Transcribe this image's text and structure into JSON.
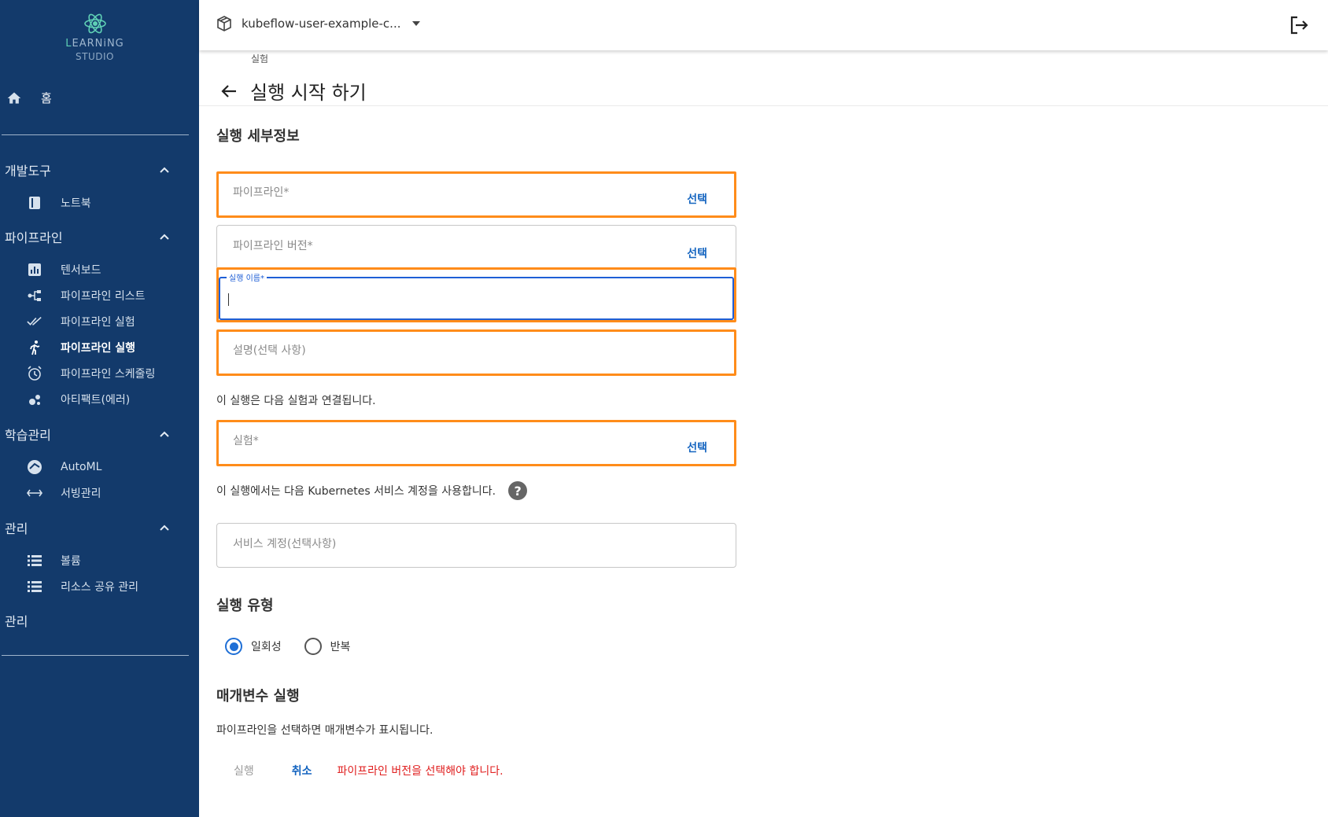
{
  "sidebar": {
    "logo_line1_highlight": "L",
    "logo_line1_rest": "EARNiNG",
    "logo_line2": "STUDIO",
    "home": "홈",
    "sections": [
      {
        "title": "개발도구",
        "items": [
          {
            "label": "노트북",
            "icon": "notebook-icon"
          }
        ]
      },
      {
        "title": "파이프라인",
        "items": [
          {
            "label": "텐서보드",
            "icon": "chart-icon"
          },
          {
            "label": "파이프라인 리스트",
            "icon": "pipeline-icon"
          },
          {
            "label": "파이프라인 실험",
            "icon": "double-check-icon"
          },
          {
            "label": "파이프라인 실행",
            "icon": "run-icon",
            "active": true
          },
          {
            "label": "파이프라인 스케줄링",
            "icon": "alarm-icon"
          },
          {
            "label": "아티팩트(에러)",
            "icon": "bubbles-icon"
          }
        ]
      },
      {
        "title": "학습관리",
        "items": [
          {
            "label": "AutoML",
            "icon": "automl-icon"
          },
          {
            "label": "서빙관리",
            "icon": "arrows-icon"
          }
        ]
      },
      {
        "title": "관리",
        "items": [
          {
            "label": "볼륨",
            "icon": "list-icon"
          },
          {
            "label": "리소스 공유 관리",
            "icon": "list-icon"
          }
        ]
      },
      {
        "title": "관리",
        "items": []
      }
    ]
  },
  "topbar": {
    "namespace": "kubeflow-user-example-c..."
  },
  "page": {
    "breadcrumb": "실험",
    "title": "실행 시작 하기",
    "run_details_heading": "실행 세부정보",
    "pipeline_placeholder": "파이프라인*",
    "pipeline_version_placeholder": "파이프라인 버전*",
    "select_label": "선택",
    "run_name_label": "실행 이름*",
    "description_placeholder": "설명(선택 사항)",
    "experiment_note": "이 실행은 다음 실험과 연결됩니다.",
    "experiment_placeholder": "실험*",
    "service_account_note": "이 실행에서는 다음 Kubernetes 서비스 계정을 사용합니다.",
    "help_glyph": "?",
    "service_account_placeholder": "서비스 계정(선택사항)",
    "run_type_heading": "실행 유형",
    "run_type_options": [
      "일회성",
      "반복"
    ],
    "run_type_selected": "일회성",
    "params_heading": "매개변수 실행",
    "params_note": "파이프라인을 선택하면 매개변수가 표시됩니다.",
    "run_button": "실행",
    "cancel_button": "취소",
    "error_message": "파이프라인 버전을 선택해야 합니다."
  },
  "colors": {
    "sidebar": "#133a6b",
    "accent": "#1565c0",
    "highlight": "#ff8c1a",
    "error": "#e02020"
  }
}
